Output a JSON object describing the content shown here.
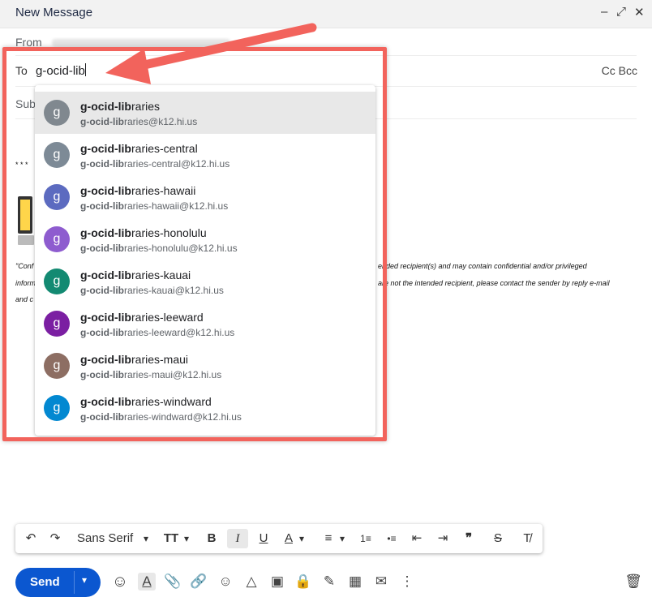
{
  "window": {
    "title": "New Message",
    "minimize": "–",
    "popout": "⤢",
    "close": "✕"
  },
  "header": {
    "from_label": "From",
    "to_label": "To",
    "to_value": "g-ocid-lib",
    "cc_bcc": "Cc Bcc",
    "subject_label": "Sub"
  },
  "body": {
    "stars": "* * *",
    "line1": "\"Conf",
    "line2": "inform",
    "line3": "and c",
    "right1": "ended recipient(s) and may contain confidential and/or privileged",
    "right2": "are not the intended recipient, please contact the sender by reply e-mail"
  },
  "suggestions": [
    {
      "initial": "g",
      "match": "g-ocid-lib",
      "rest": "raries",
      "email_match": "g-ocid-lib",
      "email_rest": "raries@k12.hi.us",
      "color": "#80888f"
    },
    {
      "initial": "g",
      "match": "g-ocid-lib",
      "rest": "raries-central",
      "email_match": "g-ocid-lib",
      "email_rest": "raries-central@k12.hi.us",
      "color": "#7d8a96"
    },
    {
      "initial": "g",
      "match": "g-ocid-lib",
      "rest": "raries-hawaii",
      "email_match": "g-ocid-lib",
      "email_rest": "raries-hawaii@k12.hi.us",
      "color": "#5c6bc0"
    },
    {
      "initial": "g",
      "match": "g-ocid-lib",
      "rest": "raries-honolulu",
      "email_match": "g-ocid-lib",
      "email_rest": "raries-honolulu@k12.hi.us",
      "color": "#8e5ccf"
    },
    {
      "initial": "g",
      "match": "g-ocid-lib",
      "rest": "raries-kauai",
      "email_match": "g-ocid-lib",
      "email_rest": "raries-kauai@k12.hi.us",
      "color": "#138a72"
    },
    {
      "initial": "g",
      "match": "g-ocid-lib",
      "rest": "raries-leeward",
      "email_match": "g-ocid-lib",
      "email_rest": "raries-leeward@k12.hi.us",
      "color": "#7b1fa2"
    },
    {
      "initial": "g",
      "match": "g-ocid-lib",
      "rest": "raries-maui",
      "email_match": "g-ocid-lib",
      "email_rest": "raries-maui@k12.hi.us",
      "color": "#8d6e63"
    },
    {
      "initial": "g",
      "match": "g-ocid-lib",
      "rest": "raries-windward",
      "email_match": "g-ocid-lib",
      "email_rest": "raries-windward@k12.hi.us",
      "color": "#0288d1"
    }
  ],
  "toolbar": {
    "undo": "↶",
    "redo": "↷",
    "font": "Sans Serif",
    "font_caret": "▾",
    "size": "TT",
    "size_caret": "▾",
    "bold": "B",
    "italic": "I",
    "underline": "U",
    "text_color": "A",
    "color_caret": "▾",
    "align": "≡",
    "align_caret": "▾",
    "numbered": "1≡",
    "bulleted": "•≡",
    "outdent": "⇤",
    "indent": "⇥",
    "quote": "❞",
    "strike": "S",
    "clear": "T̸"
  },
  "bottom": {
    "send": "Send",
    "send_caret": "▾",
    "avatar": "☺",
    "format": "A",
    "attach": "📎",
    "link": "🔗",
    "emoji": "☺",
    "drive": "△",
    "photo": "▣",
    "lock": "🔒",
    "sign": "✎",
    "layout": "▦",
    "template": "✉",
    "more": "⋮",
    "trash": "🗑"
  },
  "colors": {
    "accent": "#0b57d0",
    "highlight": "#f2635c"
  }
}
